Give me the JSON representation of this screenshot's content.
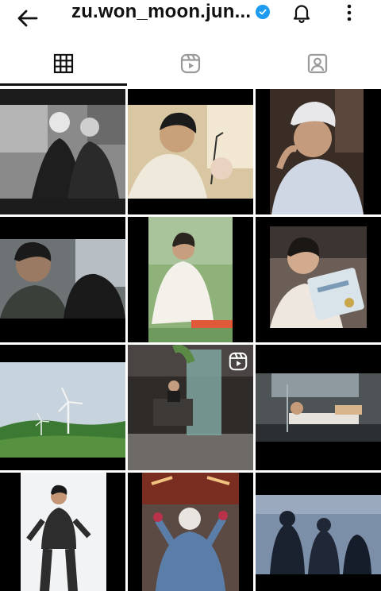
{
  "header": {
    "username": "zu.won_moon.jun...",
    "verified": true,
    "icons": {
      "back": "arrow-left-icon",
      "notifications": "bell-icon",
      "more": "more-vertical-icon"
    }
  },
  "tabs": [
    {
      "name": "posts",
      "icon": "grid-icon",
      "active": true
    },
    {
      "name": "reels",
      "icon": "reels-icon",
      "active": false
    },
    {
      "name": "tagged",
      "icon": "tagged-user-icon",
      "active": false
    }
  ],
  "colors": {
    "accent": "#111111",
    "verified_badge": "#1d9bf0",
    "tab_inactive": "#9a9a9a"
  },
  "grid": {
    "posts": [
      {
        "type": "photo"
      },
      {
        "type": "photo"
      },
      {
        "type": "photo"
      },
      {
        "type": "photo"
      },
      {
        "type": "photo"
      },
      {
        "type": "photo"
      },
      {
        "type": "photo"
      },
      {
        "type": "reel"
      },
      {
        "type": "photo"
      },
      {
        "type": "photo"
      },
      {
        "type": "photo"
      },
      {
        "type": "photo"
      }
    ]
  }
}
